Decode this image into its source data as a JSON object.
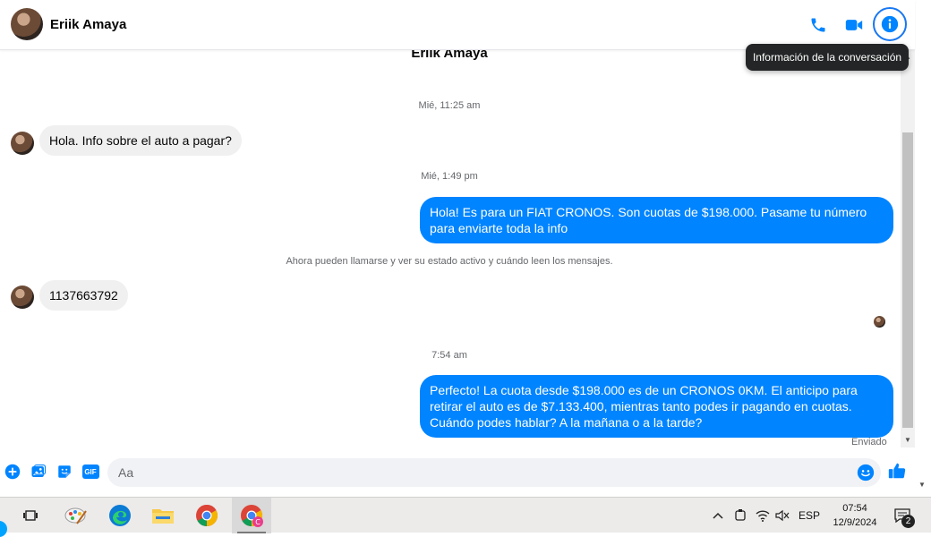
{
  "header": {
    "contact_name": "Eriik Amaya",
    "icons": [
      "phone-icon",
      "video-icon",
      "info-icon"
    ],
    "tooltip": "Información de la conversación",
    "accent": "#0084ff"
  },
  "thread": {
    "peer_name": "Eriik Amaya",
    "messages": [
      {
        "type": "timestamp",
        "text": "Mié, 11:25 am"
      },
      {
        "type": "incoming",
        "text": "Hola. Info sobre el auto a pagar?"
      },
      {
        "type": "timestamp",
        "text": "Mié, 1:49 pm"
      },
      {
        "type": "outgoing",
        "text": "Hola! Es para un FIAT CRONOS. Son cuotas de $198.000. Pasame tu número para enviarte toda la info"
      },
      {
        "type": "system",
        "text": "Ahora pueden llamarse y ver su estado activo y cuándo leen los mensajes."
      },
      {
        "type": "incoming",
        "text": "1137663792"
      },
      {
        "type": "timestamp",
        "text": "7:54 am"
      },
      {
        "type": "outgoing",
        "text": "Perfecto! La cuota desde $198.000 es de un CRONOS 0KM. El anticipo para retirar el auto es de $7.133.400, mientras tanto podes ir pagando en cuotas. Cuándo podes hablar? A la mañana o a la tarde?"
      }
    ],
    "status": "Enviado"
  },
  "composer": {
    "placeholder": "Aa",
    "icons": [
      "plus-icon",
      "image-icon",
      "sticker-icon",
      "gif-icon",
      "emoji-icon",
      "like-icon"
    ],
    "gif_label": "GIF"
  },
  "taskbar": {
    "apps": [
      "task-view-icon",
      "paint-app-icon",
      "edge-icon",
      "file-explorer-icon",
      "chrome-icon",
      "chrome-profile-icon"
    ],
    "language": "ESP",
    "time": "07:54",
    "date": "12/9/2024",
    "notification_count": "2"
  }
}
